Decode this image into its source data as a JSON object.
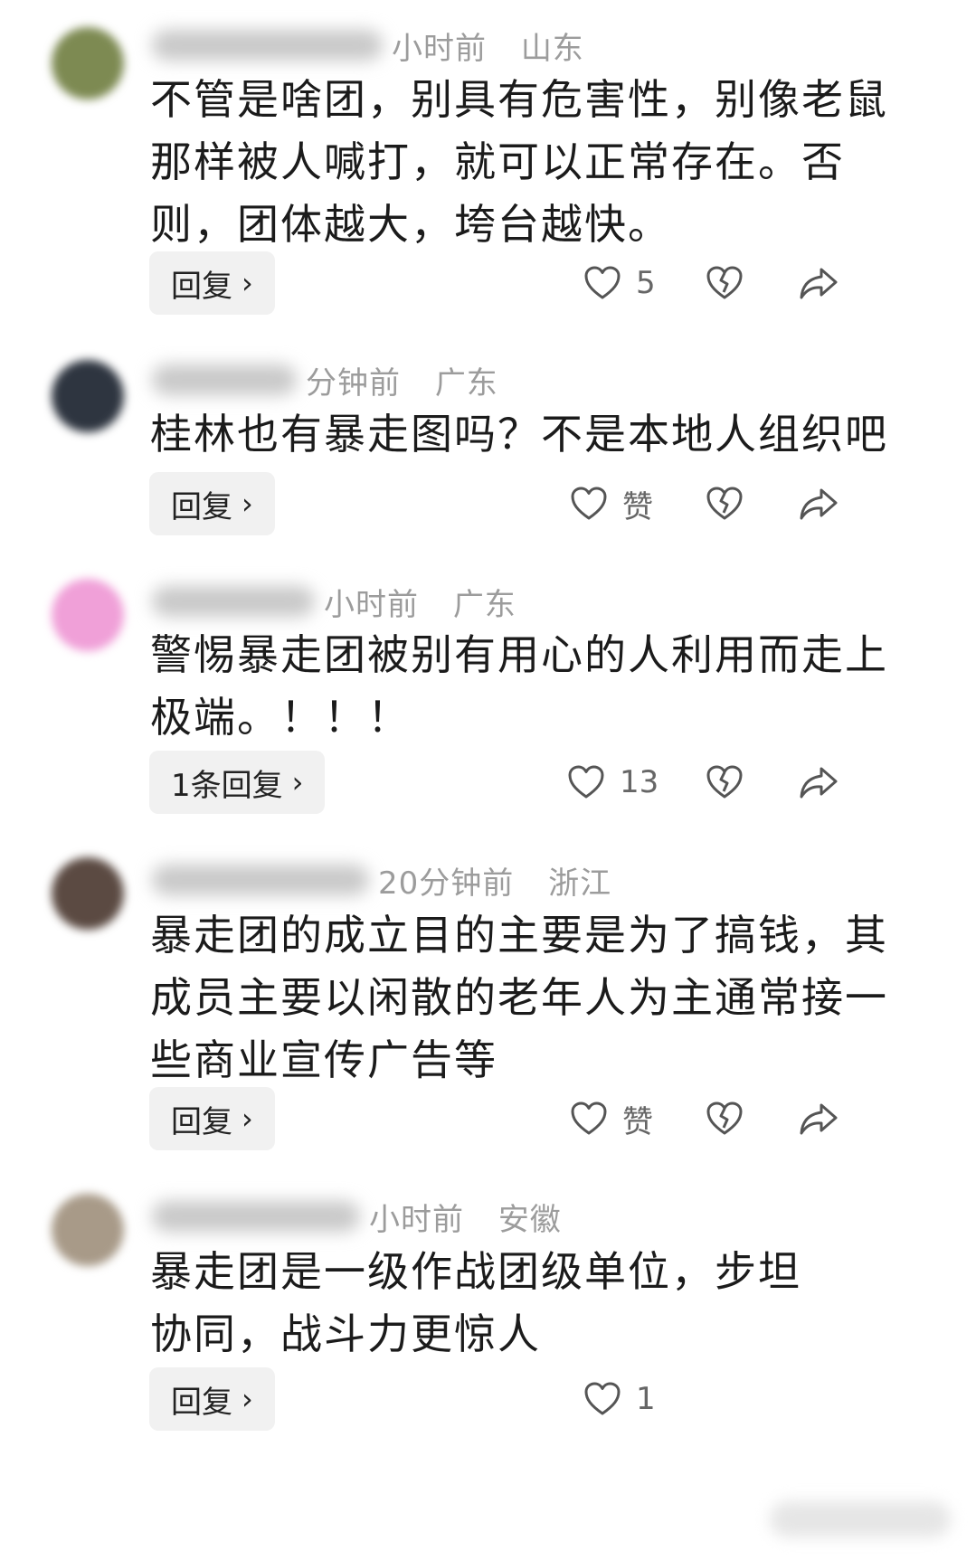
{
  "comments": [
    {
      "time": "小时前",
      "location": "山东",
      "text": "不管是啥团，别具有危害性，别像老鼠那样被人喊打，就可以正常存在。否则，团体越大，垮台越快。",
      "reply_label": "回复",
      "like": "5",
      "avatar_color": "#7d8a52"
    },
    {
      "time": "分钟前",
      "location": "广东",
      "text": "桂林也有暴走图吗？不是本地人组织吧",
      "reply_label": "回复",
      "like": "赞",
      "avatar_color": "#2e3540"
    },
    {
      "time": "小时前",
      "location": "广东",
      "text": "警惕暴走团被别有用心的人利用而走上极端。！！！",
      "reply_label": "1条回复",
      "like": "13",
      "avatar_color": "#f0a0d8"
    },
    {
      "time": "20分钟前",
      "location": "浙江",
      "text": "暴走团的成立目的主要是为了搞钱，其成员主要以闲散的老年人为主通常接一些商业宣传广告等",
      "reply_label": "回复",
      "like": "赞",
      "avatar_color": "#5b4a42"
    },
    {
      "time": "小时前",
      "location": "安徽",
      "text": "暴走团是一级作战团级单位，步坦协同，战斗力更惊人",
      "reply_label": "回复",
      "like": "1",
      "avatar_color": "#a89a88"
    }
  ],
  "icons": {
    "like": "heart-outline-icon",
    "dislike": "broken-heart-icon",
    "share": "share-arrow-icon",
    "chevron": "chevron-right-icon"
  },
  "chevron_glyph": "›"
}
